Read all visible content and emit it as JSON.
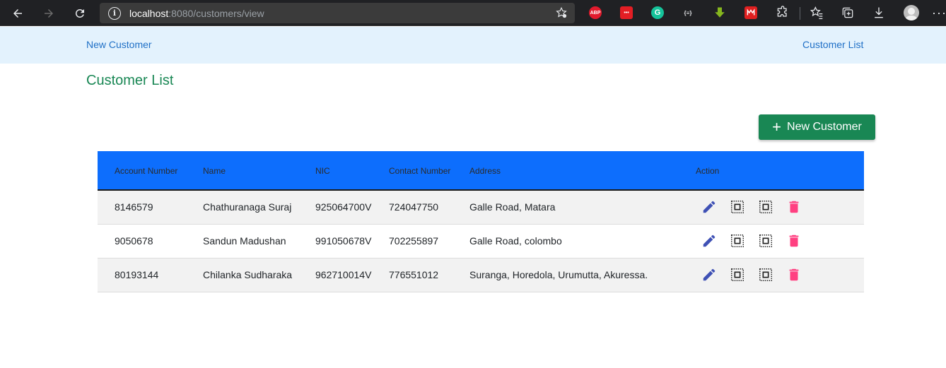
{
  "browser": {
    "url_host": "localhost",
    "url_path": ":8080/customers/view",
    "info_glyph": "i",
    "extensions": [
      {
        "name": "abp-icon",
        "label": "ABP",
        "color": "#e21b2d"
      },
      {
        "name": "dots-ext-icon",
        "label": "•••",
        "color": "#e31e24"
      },
      {
        "name": "grammarly-icon",
        "label": "G",
        "color": "#15c39a"
      },
      {
        "name": "braces-ext-icon",
        "label": "{≡}",
        "color": "#202124"
      },
      {
        "name": "download-ext-icon",
        "label": "",
        "color": "#86b71e"
      },
      {
        "name": "mega-ext-icon",
        "label": "",
        "color": "#e02020"
      }
    ]
  },
  "navbar": {
    "new_customer": "New Customer",
    "customer_list": "Customer List"
  },
  "page": {
    "title": "Customer List",
    "new_button": "New Customer",
    "plus": "+"
  },
  "table": {
    "headers": [
      "Account Number",
      "Name",
      "NIC",
      "Contact Number",
      "Address",
      "Action"
    ],
    "rows": [
      {
        "account": "8146579",
        "name": "Chathuranaga Suraj",
        "nic": "925064700V",
        "contact": "724047750",
        "address": "Galle Road, Matara"
      },
      {
        "account": "9050678",
        "name": "Sandun Madushan",
        "nic": "991050678V",
        "contact": "702255897",
        "address": "Galle Road, colombo"
      },
      {
        "account": "80193144",
        "name": "Chilanka Sudharaka",
        "nic": "962710014V",
        "contact": "776551012",
        "address": "Suranga, Horedola, Urumutta, Akuressa."
      }
    ]
  },
  "colors": {
    "header_bg": "#0d6efd",
    "edit_icon": "#3f51b5",
    "delete_icon": "#ff4081",
    "success": "#198754"
  }
}
